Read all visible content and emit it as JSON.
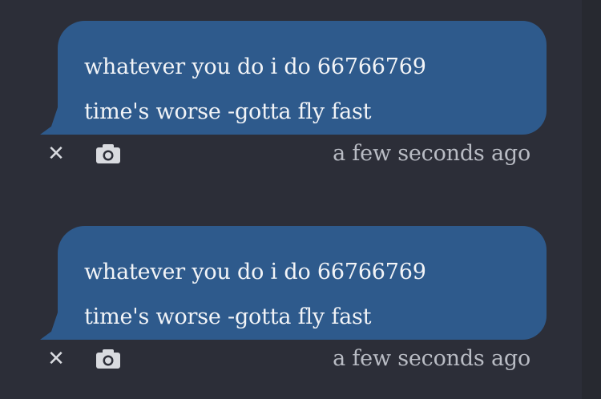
{
  "messages": [
    {
      "lines": [
        "whatever you do i do 66766769",
        "time's worse -gotta fly fast"
      ],
      "timestamp": "a few seconds ago",
      "actions": {
        "delete_icon": "close-icon",
        "screenshot_icon": "camera-icon"
      }
    },
    {
      "lines": [
        "whatever you do i do 66766769",
        "time's worse -gotta fly fast"
      ],
      "timestamp": "a few seconds ago",
      "actions": {
        "delete_icon": "close-icon",
        "screenshot_icon": "camera-icon"
      }
    }
  ],
  "colors": {
    "background": "#2c2e38",
    "bubble": "#2e5a8c",
    "text": "#f2f4f7",
    "meta_text": "#b9bcc4"
  }
}
